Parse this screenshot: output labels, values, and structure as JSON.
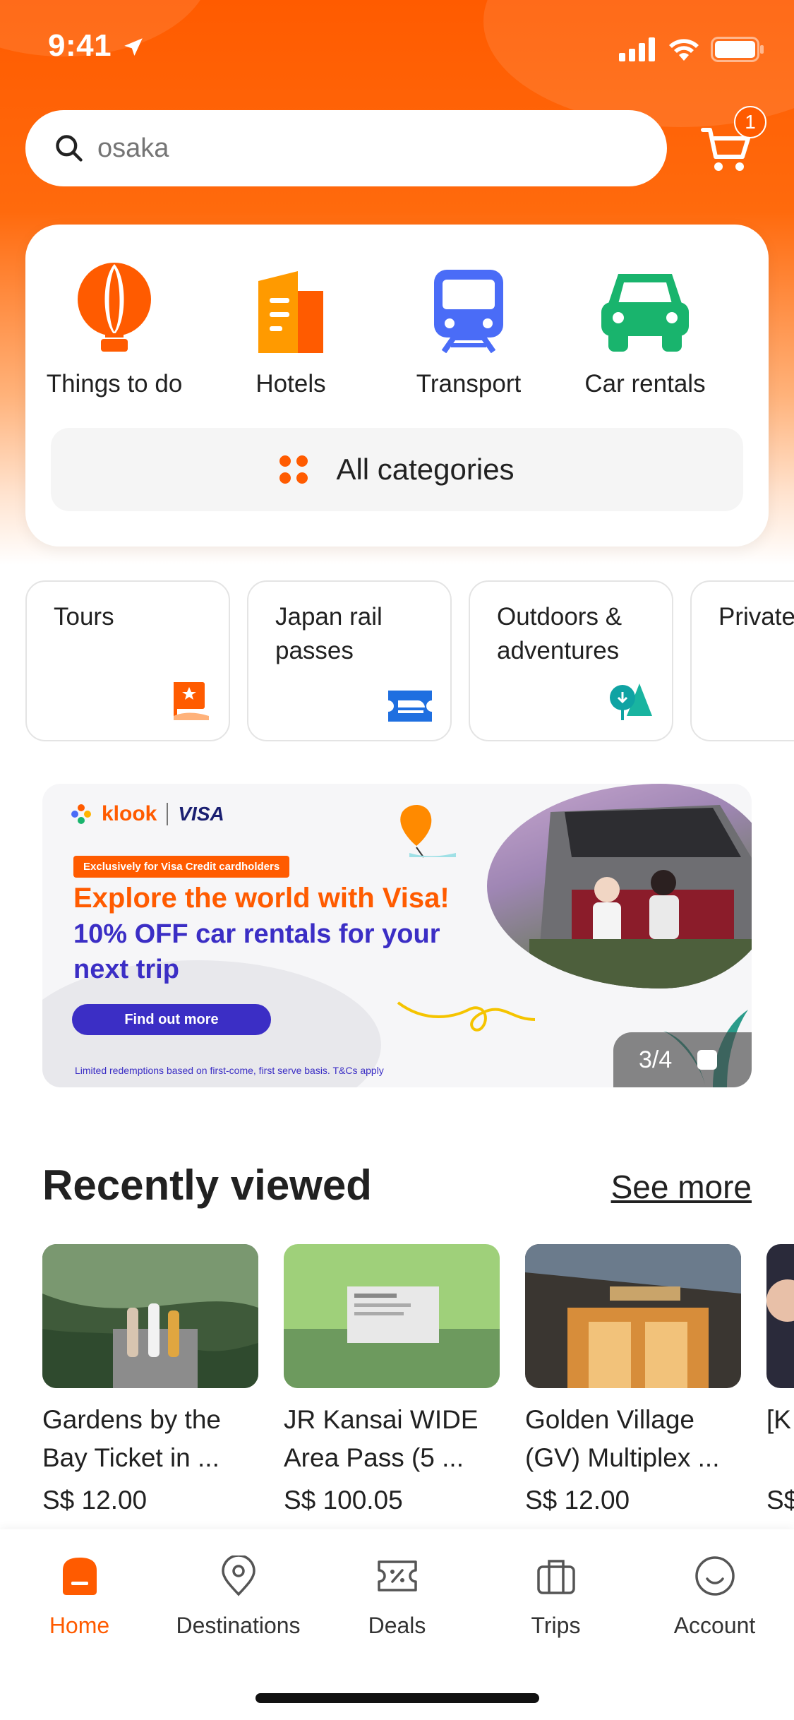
{
  "status_bar": {
    "time": "9:41"
  },
  "search": {
    "placeholder": "osaka",
    "cart_count": "1"
  },
  "categories": [
    {
      "label": "Things to do",
      "icon": "hot-air-balloon-icon",
      "color": "#ff5b00"
    },
    {
      "label": "Hotels",
      "icon": "hotel-building-icon",
      "color": "#ff8a00"
    },
    {
      "label": "Transport",
      "icon": "train-icon",
      "color": "#4a6cf7"
    },
    {
      "label": "Car rentals",
      "icon": "car-icon",
      "color": "#19b46d"
    }
  ],
  "all_categories_label": "All categories",
  "chips": [
    {
      "label": "Tours",
      "icon": "flag-icon"
    },
    {
      "label": "Japan rail passes",
      "icon": "rail-ticket-icon"
    },
    {
      "label": "Outdoors & adventures",
      "icon": "trees-icon"
    },
    {
      "label": "Private airport",
      "icon": ""
    }
  ],
  "banner": {
    "brand": "klook",
    "partner": "VISA",
    "tag": "Exclusively for Visa Credit cardholders",
    "headline": "Explore the world with Visa!",
    "subhead": "10% OFF car rentals for your next trip",
    "cta": "Find out more",
    "fine_print": "Limited redemptions based on first-come, first serve basis. T&Cs apply",
    "counter": "3/4"
  },
  "recently_viewed": {
    "title": "Recently viewed",
    "see_more": "See more",
    "items": [
      {
        "title": "Gardens by the Bay Ticket in ...",
        "price": "S$ 12.00"
      },
      {
        "title": "JR Kansai WIDE Area Pass (5 ...",
        "price": "S$ 100.05"
      },
      {
        "title": "Golden Village (GV) Multiplex ...",
        "price": "S$ 12.00"
      },
      {
        "title": "[K Exc",
        "price": "S$"
      }
    ]
  },
  "tabs": [
    {
      "label": "Home",
      "icon": "home-icon",
      "active": true
    },
    {
      "label": "Destinations",
      "icon": "location-pin-icon",
      "active": false
    },
    {
      "label": "Deals",
      "icon": "discount-ticket-icon",
      "active": false
    },
    {
      "label": "Trips",
      "icon": "suitcase-icon",
      "active": false
    },
    {
      "label": "Account",
      "icon": "smiley-icon",
      "active": false
    }
  ],
  "colors": {
    "accent": "#ff5b00",
    "visa_blue": "#3b2ec5"
  }
}
